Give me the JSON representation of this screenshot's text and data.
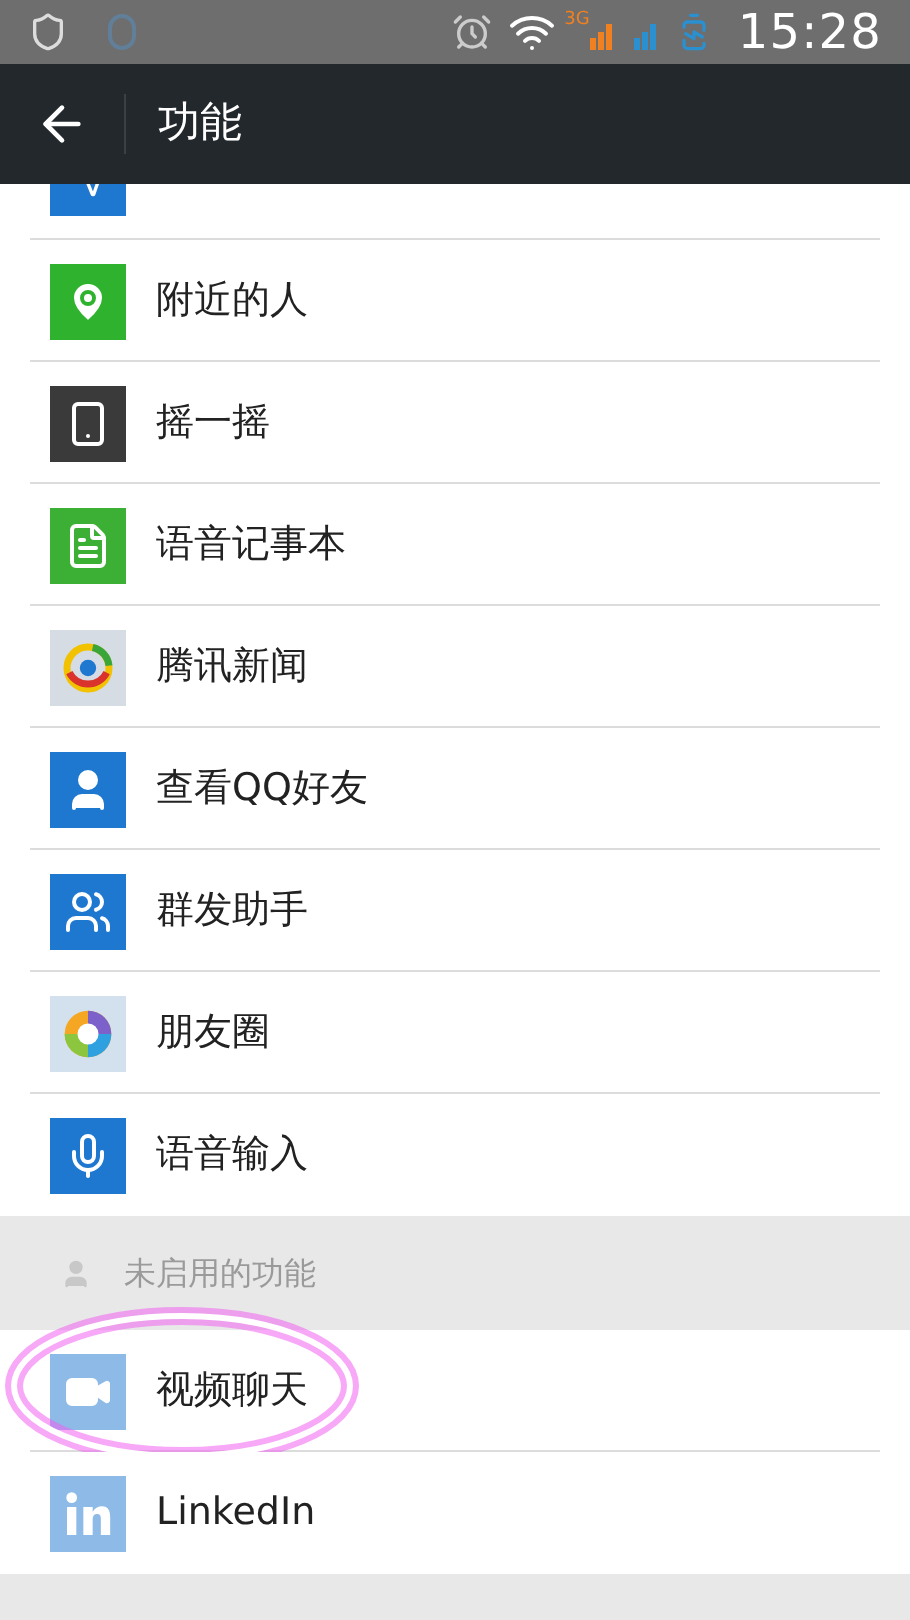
{
  "status_bar": {
    "network": "3G",
    "time": "15:28"
  },
  "app_bar": {
    "title": "功能"
  },
  "enabled_features": [
    {
      "label": "附近的人"
    },
    {
      "label": "摇一摇"
    },
    {
      "label": "语音记事本"
    },
    {
      "label": "腾讯新闻"
    },
    {
      "label": "查看QQ好友"
    },
    {
      "label": "群发助手"
    },
    {
      "label": "朋友圈"
    },
    {
      "label": "语音输入"
    }
  ],
  "disabled_section": {
    "header": "未启用的功能",
    "items": [
      {
        "label": "视频聊天",
        "disabled": true,
        "circled": true
      },
      {
        "label": "LinkedIn",
        "disabled": true,
        "circled": false
      }
    ]
  }
}
